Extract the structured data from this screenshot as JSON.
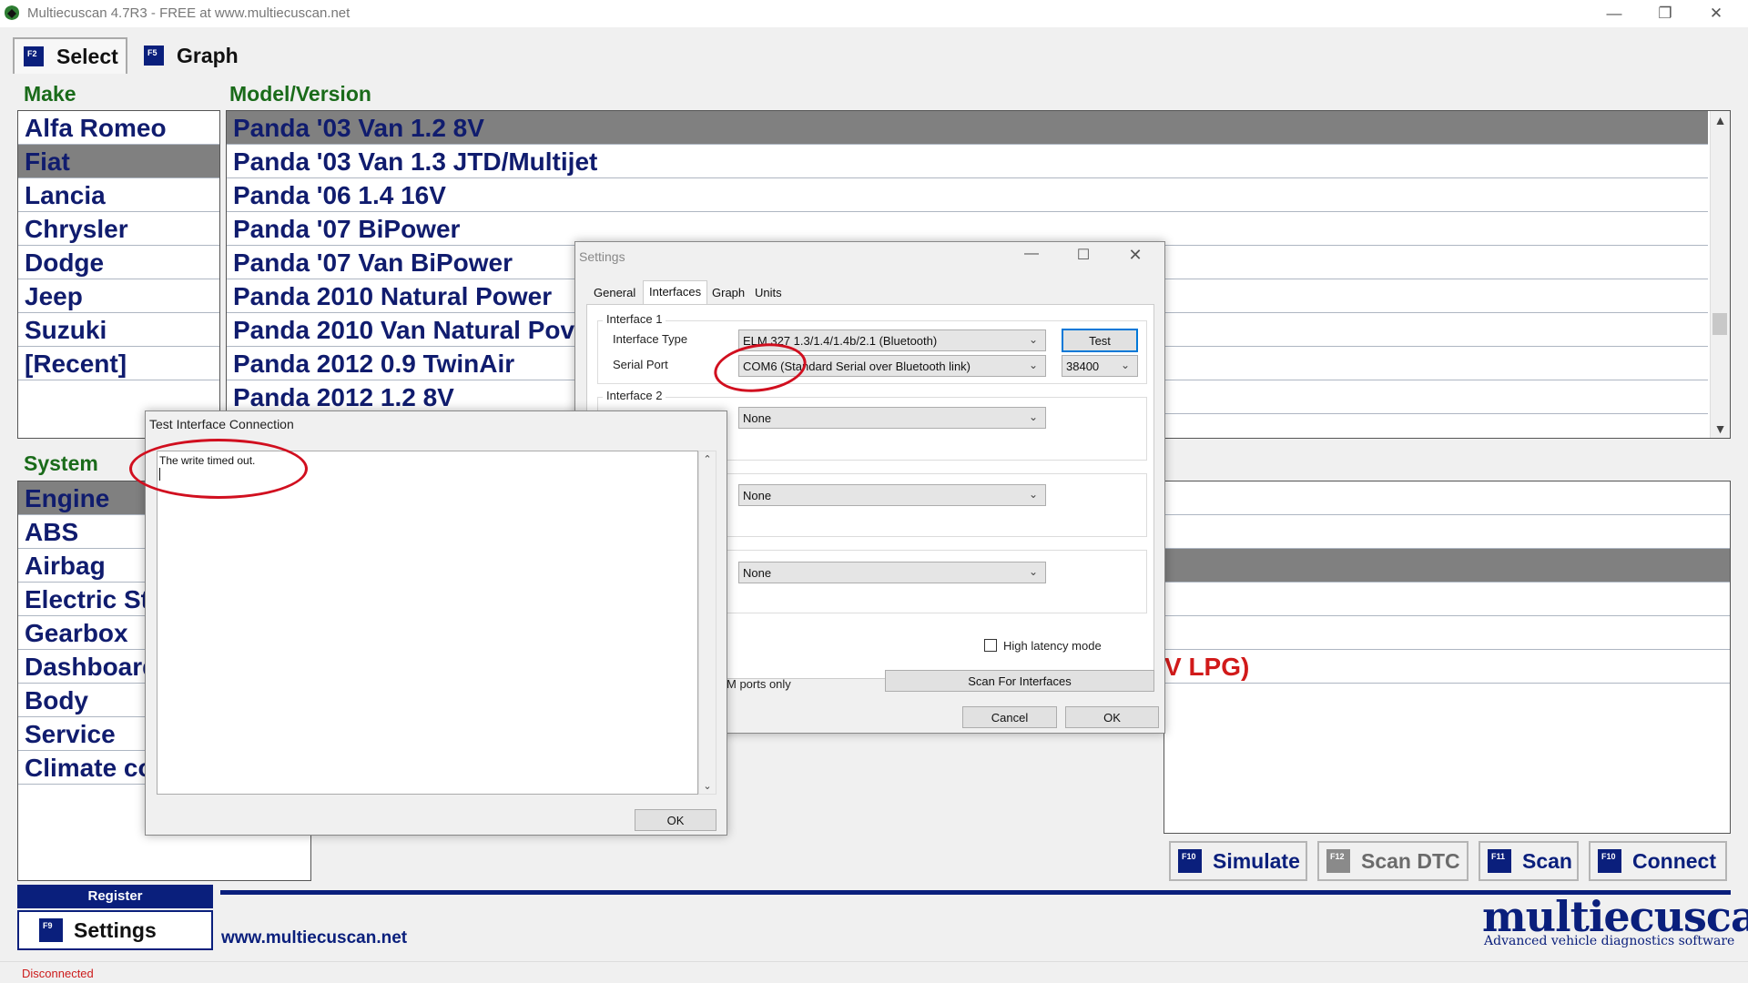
{
  "window": {
    "title": "Multiecuscan 4.7R3 - FREE at www.multiecuscan.net",
    "minimize": "—",
    "restore": "❐",
    "close": "✕"
  },
  "toptabs": [
    {
      "key": "F2",
      "label": "Select"
    },
    {
      "key": "F5",
      "label": "Graph"
    }
  ],
  "make": {
    "header": "Make",
    "items": [
      "Alfa Romeo",
      "Fiat",
      "Lancia",
      "Chrysler",
      "Dodge",
      "Jeep",
      "Suzuki",
      "[Recent]"
    ],
    "selected": "Fiat"
  },
  "model": {
    "header": "Model/Version",
    "items": [
      "Panda '03 Van 1.2 8V",
      "Panda '03 Van 1.3 JTD/Multijet",
      "Panda '06 1.4 16V",
      "Panda '07 BiPower",
      "Panda '07 Van BiPower",
      "Panda 2010 Natural Power",
      "Panda 2010 Van Natural Pov",
      "Panda 2012 0.9 TwinAir",
      "Panda 2012 1.2 8V"
    ],
    "selected": "Panda '03 Van 1.2 8V"
  },
  "system": {
    "header": "System",
    "items": [
      "Engine",
      "ABS",
      "Airbag",
      "Electric St",
      "Gearbox",
      "Dashboard",
      "Body",
      "Service",
      "Climate co"
    ],
    "selected": "Engine"
  },
  "right_list": {
    "visible_text": "V LPG)"
  },
  "buttons": [
    {
      "key": "F10",
      "sub": "CTRL+",
      "label": "Simulate"
    },
    {
      "key": "F12",
      "label": "Scan DTC"
    },
    {
      "key": "F11",
      "label": "Scan"
    },
    {
      "key": "F10",
      "label": "Connect"
    }
  ],
  "register_label": "Register",
  "settings_button": {
    "key": "F9",
    "label": "Settings"
  },
  "website": "www.multiecuscan.net",
  "logo": {
    "name": "multiecuscan",
    "tagline": "Advanced vehicle diagnostics software"
  },
  "status": "Disconnected",
  "settings_dialog": {
    "title": "Settings",
    "tabs": [
      "General",
      "Interfaces",
      "Graph",
      "Units"
    ],
    "active_tab": "Interfaces",
    "interface1": {
      "label": "Interface 1",
      "type_label": "Interface Type",
      "type_value": "ELM 327 1.3/1.4/1.4b/2.1 (Bluetooth)",
      "test_button": "Test",
      "port_label": "Serial Port",
      "port_value": "COM6   (Standard Serial over Bluetooth link)",
      "baud_value": "38400"
    },
    "interface2": {
      "label": "Interface 2",
      "type_value": "None"
    },
    "interface3": {
      "type_value": "None"
    },
    "interface4": {
      "type_value": "None"
    },
    "high_latency": "High latency mode",
    "ports_only": "M ports only",
    "scan_interfaces": "Scan For Interfaces",
    "cancel": "Cancel",
    "ok": "OK"
  },
  "test_dialog": {
    "title": "Test Interface Connection",
    "message": "The write timed out.",
    "ok": "OK"
  },
  "colors": {
    "navy": "#0a1f7c",
    "list_text": "#101c6e",
    "section_green": "#1a6b1a",
    "selected_row": "#808080",
    "annotation_red": "#d10f1f"
  }
}
